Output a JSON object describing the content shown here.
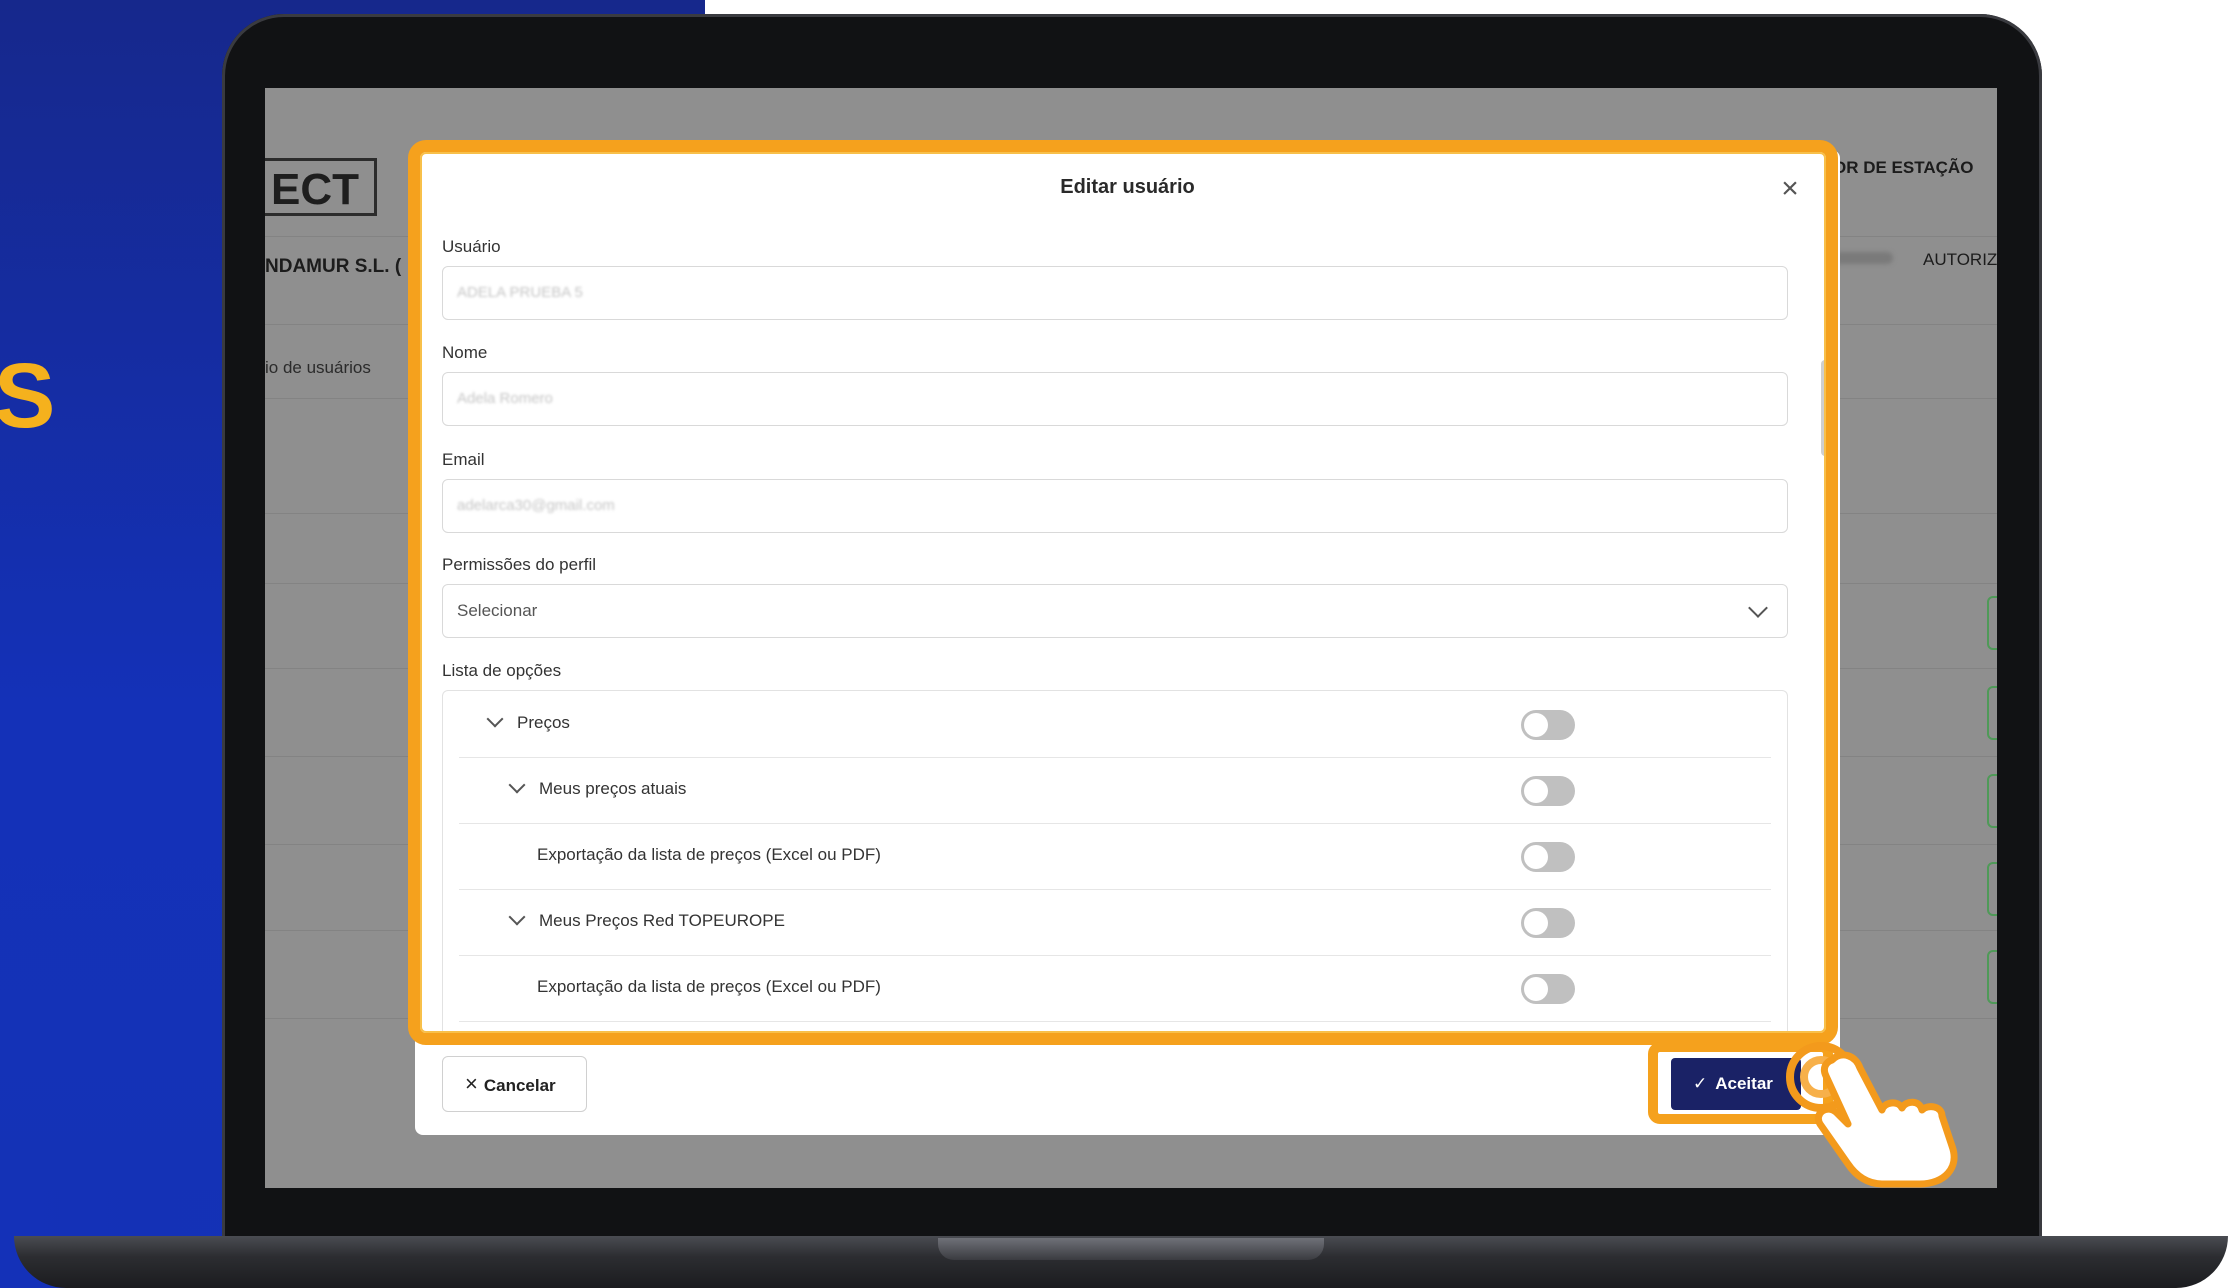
{
  "brand": {
    "side_letter": "S",
    "accent": "#f5a11d",
    "blue": "#1431b8"
  },
  "background_app": {
    "logo": "ECT",
    "company": "NDAMUR S.L. (",
    "breadcrumb": "io de usuários",
    "station_label": "OR DE ESTAÇÃO",
    "autoriz_label": "AUTORIZ"
  },
  "modal": {
    "title": "Editar usuário",
    "fields": {
      "usuario": {
        "label": "Usuário",
        "value": "ADELA PRUEBA 5"
      },
      "nome": {
        "label": "Nome",
        "value": "Adela Romero"
      },
      "email": {
        "label": "Email",
        "value": "adelarca30@gmail.com"
      },
      "permissoes": {
        "label": "Permissões do perfil",
        "value": "Selecionar"
      }
    },
    "options": {
      "label": "Lista de opções",
      "items": [
        {
          "label": "Preços",
          "level": 0,
          "expanded": true,
          "enabled": false
        },
        {
          "label": "Meus preços atuais",
          "level": 1,
          "expanded": true,
          "enabled": false
        },
        {
          "label": "Exportação da lista de preços (Excel ou PDF)",
          "level": 2,
          "expanded": false,
          "enabled": false
        },
        {
          "label": "Meus Preços Red TOPEUROPE",
          "level": 1,
          "expanded": true,
          "enabled": false
        },
        {
          "label": "Exportação da lista de preços (Excel ou PDF)",
          "level": 2,
          "expanded": false,
          "enabled": false
        }
      ]
    },
    "cancel_label": "Cancelar",
    "accept_label": "Aceitar"
  }
}
